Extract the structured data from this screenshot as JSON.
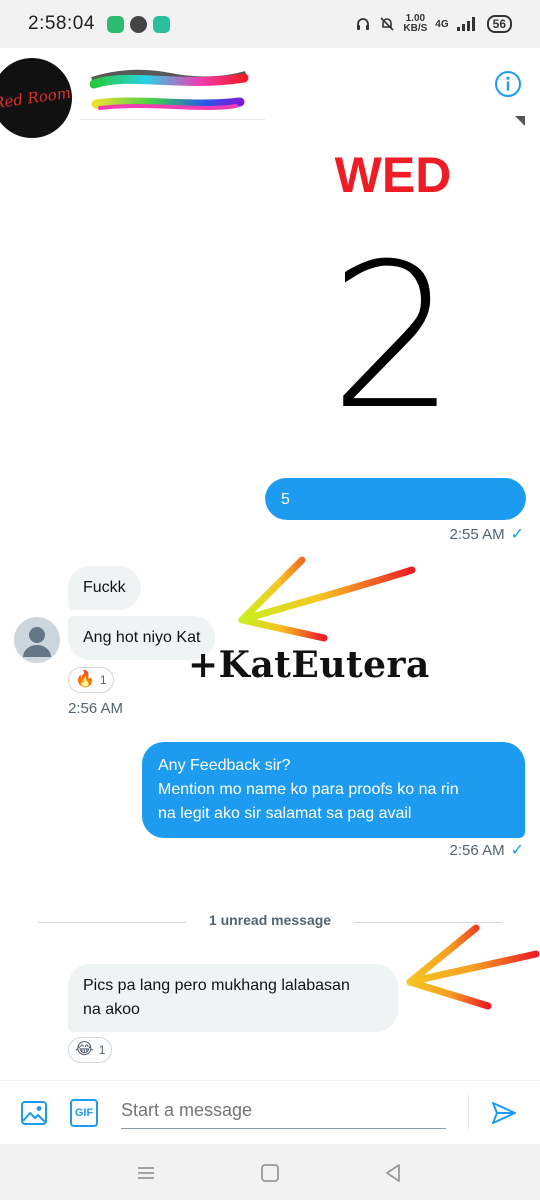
{
  "status_bar": {
    "time": "2:58:04",
    "net_speed_value": "1.00",
    "net_speed_unit": "KB/S",
    "network": "4G",
    "battery": "56",
    "app_icons": [
      "chat-app-icon",
      "messenger-icon",
      "message-app-icon"
    ]
  },
  "header": {
    "profile_brand": "Red Room",
    "info_icon": "info-icon"
  },
  "sent_card": {
    "day": "WED",
    "number": "2",
    "caption": "5",
    "time": "2:55 AM"
  },
  "received_group_1": {
    "messages": [
      "Fuckk",
      "Ang hot niyo Kat"
    ],
    "reaction_emoji": "🔥",
    "reaction_count": "1",
    "time": "2:56 AM"
  },
  "annotation": {
    "watermark": "+KatEutera"
  },
  "sent_message": {
    "line1": "Any Feedback sir?",
    "line2": "Mention mo name ko para proofs ko na rin",
    "line3": "na legit ako sir salamat sa pag avail",
    "time": "2:56 AM"
  },
  "unread_divider": "1 unread message",
  "received_group_2": {
    "line1": "Pics pa lang pero mukhang lalabasan",
    "line2": "na akoo",
    "reaction_emoji": "😂",
    "reaction_count": "1"
  },
  "composer": {
    "placeholder": "Start a message",
    "gif_label": "GIF"
  },
  "colors": {
    "accent": "#1d9bf0",
    "bubble_received": "#eff3f4",
    "timestamp": "#536471",
    "day_red": "#ee1c24"
  }
}
